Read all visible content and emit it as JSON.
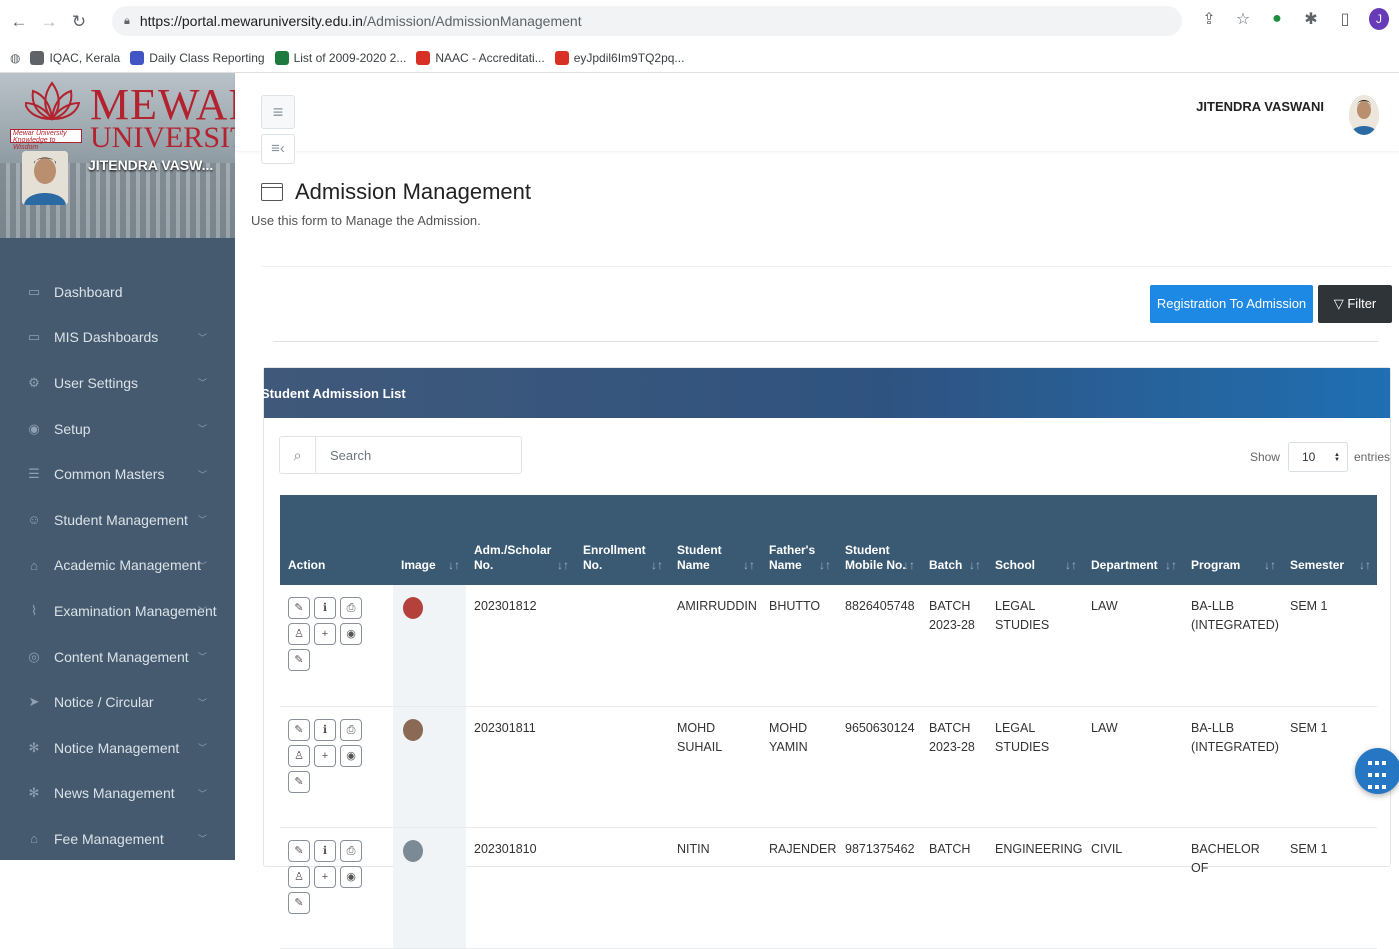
{
  "browser": {
    "url_host": "https://portal.mewaruniversity.edu.in",
    "url_path": "/Admission/AdmissionManagement",
    "profile_initial": "J",
    "bookmarks": [
      {
        "label": "IQAC, Kerala",
        "color": "#5f6368"
      },
      {
        "label": "Daily Class Reporting",
        "color": "#4255c5"
      },
      {
        "label": "List of 2009-2020 2...",
        "color": "#1d7a3f"
      },
      {
        "label": "NAAC - Accreditati...",
        "color": "#d93025"
      },
      {
        "label": "eyJpdil6Im9TQ2pq...",
        "color": "#d93025"
      }
    ]
  },
  "sidebar": {
    "logo_top": "MEWAR",
    "logo_bottom": "UNIVERSITY",
    "logo_tagline": "Mewar University Knowledge to Wisdom",
    "user_name": "JITENDRA VASW...",
    "items": [
      {
        "label": "Dashboard",
        "icon": "calendar-icon",
        "glyph": "▭",
        "has_chevron": false
      },
      {
        "label": "MIS Dashboards",
        "icon": "calendar-icon",
        "glyph": "▭",
        "has_chevron": true
      },
      {
        "label": "User Settings",
        "icon": "gear-icon",
        "glyph": "⚙",
        "has_chevron": true
      },
      {
        "label": "Setup",
        "icon": "toggle-icon",
        "glyph": "◉",
        "has_chevron": true
      },
      {
        "label": "Common Masters",
        "icon": "list-icon",
        "glyph": "☰",
        "has_chevron": true
      },
      {
        "label": "Student Management",
        "icon": "users-icon",
        "glyph": "☺",
        "has_chevron": true
      },
      {
        "label": "Academic Management",
        "icon": "graduation-cap-icon",
        "glyph": "⌂",
        "has_chevron": true
      },
      {
        "label": "Examination Management",
        "icon": "rss-icon",
        "glyph": "⌇",
        "has_chevron": true
      },
      {
        "label": "Content Management",
        "icon": "target-icon",
        "glyph": "◎",
        "has_chevron": true
      },
      {
        "label": "Notice / Circular",
        "icon": "send-icon",
        "glyph": "➤",
        "has_chevron": true
      },
      {
        "label": "Notice Management",
        "icon": "snowflake-icon",
        "glyph": "✻",
        "has_chevron": true
      },
      {
        "label": "News Management",
        "icon": "snowflake-icon",
        "glyph": "✻",
        "has_chevron": true
      },
      {
        "label": "Fee Management",
        "icon": "bank-icon",
        "glyph": "⌂",
        "has_chevron": true
      }
    ]
  },
  "header": {
    "user_name": "JITENDRA VASWANI"
  },
  "page": {
    "title": "Admission Management",
    "subtitle": "Use this form to Manage the Admission.",
    "registration_button": "Registration To Admission",
    "filter_button": "Filter"
  },
  "list": {
    "title": "Student Admission List",
    "search_placeholder": "Search",
    "show_label": "Show",
    "entries_value": "10",
    "entries_label": "entries",
    "columns": [
      "Action",
      "Image",
      "Adm./Scholar No.",
      "Enrollment No.",
      "Student Name",
      "Father's Name",
      "Student Mobile No.",
      "Batch",
      "School",
      "Department",
      "Program",
      "Semester"
    ],
    "rows": [
      {
        "adm_no": "202301812",
        "enrollment": "",
        "student": "AMIRRUDDIN",
        "father": "BHUTTO",
        "mobile": "8826405748",
        "batch": "BATCH 2023-28",
        "school": "LEGAL STUDIES",
        "department": "LAW",
        "program": "BA-LLB (INTEGRATED)",
        "semester": "SEM 1",
        "thumb_color": "#b5413d"
      },
      {
        "adm_no": "202301811",
        "enrollment": "",
        "student": "MOHD SUHAIL",
        "father": "MOHD YAMIN",
        "mobile": "9650630124",
        "batch": "BATCH 2023-28",
        "school": "LEGAL STUDIES",
        "department": "LAW",
        "program": "BA-LLB (INTEGRATED)",
        "semester": "SEM 1",
        "thumb_color": "#8a6a55"
      },
      {
        "adm_no": "202301810",
        "enrollment": "",
        "student": "NITIN",
        "father": "RAJENDER",
        "mobile": "9871375462",
        "batch": "BATCH",
        "school": "ENGINEERING",
        "department": "CIVIL",
        "program": "BACHELOR OF",
        "semester": "SEM 1",
        "thumb_color": "#7c8a96"
      }
    ]
  }
}
